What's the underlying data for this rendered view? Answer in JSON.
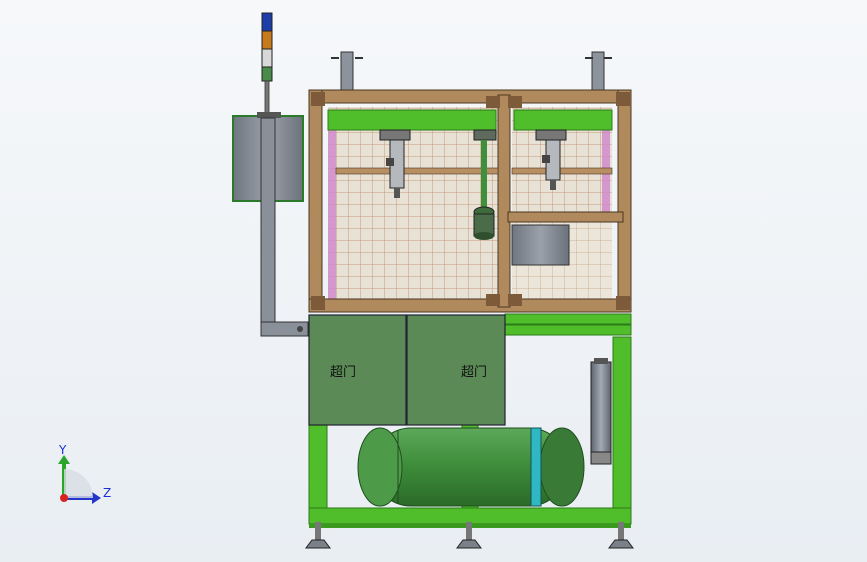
{
  "app": {
    "view": "cad-model-viewport"
  },
  "model": {
    "cabinet_door_left_label": "超门",
    "cabinet_door_right_label": "超门",
    "frame_color": "#4fbe2a",
    "aluminum_color": "#b08a5c",
    "cabinet_color": "#5b8a57",
    "tank_color": "#3f8f3c",
    "signal_tower_colors": [
      "#1d3ea8",
      "#c77a1a",
      "#d8d8d8"
    ]
  },
  "triad": {
    "y_label": "Y",
    "z_label": "Z",
    "x_color": "#d8231e",
    "y_color": "#2aa52a",
    "z_color": "#2536c9"
  }
}
